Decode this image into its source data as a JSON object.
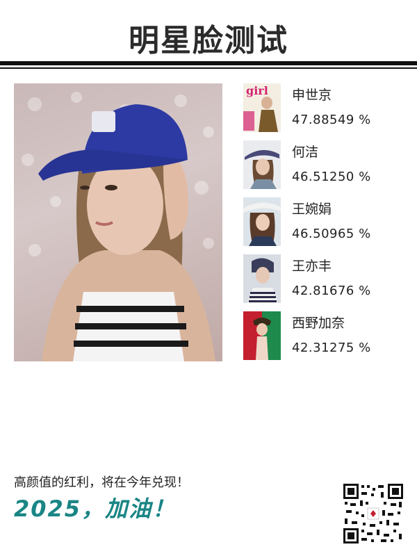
{
  "header": {
    "title": "明星脸测试"
  },
  "matches": [
    {
      "name": "申世京",
      "score": "47.88549 %"
    },
    {
      "name": "何洁",
      "score": "46.51250 %"
    },
    {
      "name": "王婉娟",
      "score": "46.50965 %"
    },
    {
      "name": "王亦丰",
      "score": "42.81676 %"
    },
    {
      "name": "西野加奈",
      "score": "42.31275 %"
    }
  ],
  "footer": {
    "slogan": "高颜值的红利，将在今年兑现！",
    "cheer": "2025，加油！"
  },
  "colors": {
    "accent": "#1a8585",
    "text": "#222222"
  }
}
